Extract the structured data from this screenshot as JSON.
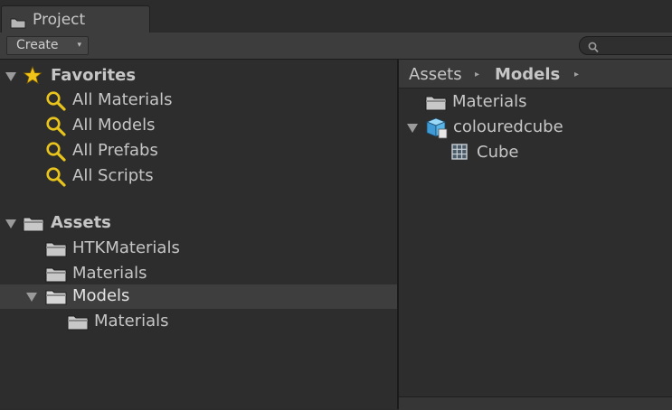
{
  "window": {
    "tab_label": "Project"
  },
  "toolbar": {
    "create_label": "Create",
    "create_arrow": "▾",
    "search_value": "",
    "search_placeholder": ""
  },
  "tree": {
    "favorites": {
      "label": "Favorites",
      "items": [
        {
          "label": "All Materials"
        },
        {
          "label": "All Models"
        },
        {
          "label": "All Prefabs"
        },
        {
          "label": "All Scripts"
        }
      ]
    },
    "assets": {
      "label": "Assets",
      "items": [
        {
          "label": "HTKMaterials"
        },
        {
          "label": "Materials"
        },
        {
          "label": "Models",
          "expanded": true,
          "selected": true
        },
        {
          "label": "Materials",
          "indent": 1
        }
      ]
    }
  },
  "breadcrumb": {
    "items": [
      "Assets",
      "Models"
    ],
    "separator": "▸"
  },
  "content": {
    "items": [
      {
        "label": "Materials",
        "icon": "folder-icon"
      },
      {
        "label": "colouredcube",
        "icon": "prefab-cube-icon",
        "expanded": true
      },
      {
        "label": "Cube",
        "icon": "mesh-icon",
        "indent": 1
      }
    ]
  },
  "colors": {
    "background": "#2d2d2d",
    "toolbar": "#3d3d3d",
    "selection": "#3e3e3e",
    "star": "#f0c419",
    "search_icon": "#e8c41c",
    "cube": "#5ab4e8"
  }
}
